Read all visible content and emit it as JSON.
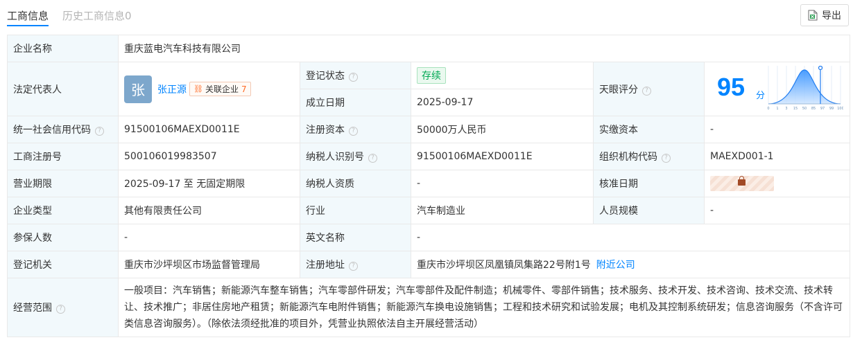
{
  "tabs": [
    {
      "label": "工商信息"
    },
    {
      "label": "历史工商信息0"
    }
  ],
  "export": {
    "label": "导出",
    "icon": "excel-icon"
  },
  "company": {
    "name_label": "企业名称",
    "name": "重庆蓝电汽车科技有限公司",
    "legal_rep_label": "法定代表人",
    "legal_rep_avatar": "张",
    "legal_rep_name": "张正源",
    "related_label": "关联企业",
    "related_count": "7",
    "reg_status_label": "登记状态",
    "reg_status": "存续",
    "founded_label": "成立日期",
    "founded": "2025-09-17",
    "tianyan_label": "天眼评分",
    "score": "95",
    "score_unit": "分",
    "credit_code_label": "统一社会信用代码",
    "credit_code": "91500106MAEXD0011E",
    "reg_capital_label": "注册资本",
    "reg_capital": "50000万人民币",
    "paid_capital_label": "实缴资本",
    "paid_capital": "-",
    "reg_no_label": "工商注册号",
    "reg_no": "500106019983507",
    "taxpayer_id_label": "纳税人识别号",
    "taxpayer_id": "91500106MAEXD0011E",
    "org_code_label": "组织机构代码",
    "org_code": "MAEXD001-1",
    "term_label": "营业期限",
    "term": "2025-09-17 至 无固定期限",
    "taxpayer_qual_label": "纳税人资质",
    "taxpayer_qual": "-",
    "approval_date_label": "核准日期",
    "type_label": "企业类型",
    "type": "其他有限责任公司",
    "industry_label": "行业",
    "industry": "汽车制造业",
    "staff_label": "人员规模",
    "staff": "-",
    "insured_label": "参保人数",
    "insured": "-",
    "english_name_label": "英文名称",
    "english_name": "-",
    "authority_label": "登记机关",
    "authority": "重庆市沙坪坝区市场监督管理局",
    "address_label": "注册地址",
    "address": "重庆市沙坪坝区凤凰镇凤集路22号附1号",
    "nearby_label": "附近公司",
    "scope_label": "经营范围",
    "scope": "一般项目：汽车销售；新能源汽车整车销售；汽车零部件研发；汽车零部件及配件制造；机械零件、零部件销售；技术服务、技术开发、技术咨询、技术交流、技术转让、技术推广；非居住房地产租赁；新能源汽车电附件销售；新能源汽车换电设施销售；工程和技术研究和试验发展；电机及其控制系统研发；信息咨询服务（不含许可类信息咨询服务）。（除依法须经批准的项目外，凭营业执照依法自主开展经营活动）"
  },
  "score_chart": {
    "ticks": [
      "0",
      "1",
      "3",
      "15",
      "50",
      "85",
      "97",
      "99",
      "100"
    ],
    "marker_value": 95
  },
  "colors": {
    "accent": "#0084ff",
    "label_bg": "#f2f9fc",
    "status_green": "#00a853",
    "related_orange": "#ff6a25"
  }
}
